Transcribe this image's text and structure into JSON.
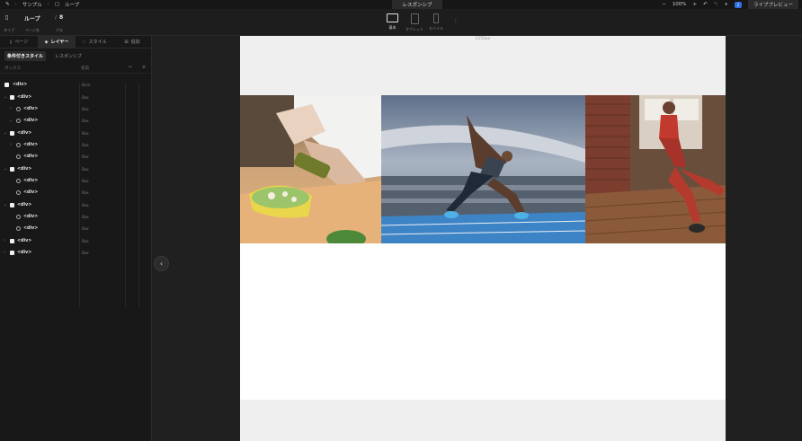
{
  "topbar": {
    "breadcrumb": [
      "サンプル",
      "ループ"
    ],
    "center_tab": "レスポンシブ",
    "zoom": "100%",
    "badge": "2",
    "live_preview": "ライブプレビュー"
  },
  "toolbar": {
    "type_label": "タイプ",
    "page_name": "ループ",
    "page_name_label": "ページ名",
    "path": "8",
    "path_label": "パス",
    "devices": [
      {
        "label": "基本",
        "active": true
      },
      {
        "label": "タブレット",
        "active": false
      },
      {
        "label": "モバイル",
        "active": false
      }
    ]
  },
  "left_panel": {
    "tabs": [
      "ページ",
      "レイヤー",
      "スタイル",
      "追加"
    ],
    "sub_tabs": [
      "条件付きスタイル",
      "レスポンシブ"
    ],
    "col_box": "ボックス",
    "col_name": "名前",
    "layers": [
      {
        "tag": "<div>",
        "name": "Box",
        "indent": 0,
        "kind": "box",
        "chev": ""
      },
      {
        "tag": "<div>",
        "name": "Box",
        "indent": 1,
        "kind": "box",
        "chev": "v"
      },
      {
        "tag": "<div>",
        "name": "Box",
        "indent": 2,
        "kind": "gear",
        "chev": ">"
      },
      {
        "tag": "<div>",
        "name": "Box",
        "indent": 2,
        "kind": "gear",
        "chev": ">"
      },
      {
        "tag": "<div>",
        "name": "Box",
        "indent": 1,
        "kind": "box",
        "chev": "v"
      },
      {
        "tag": "<div>",
        "name": "Box",
        "indent": 2,
        "kind": "gear",
        "chev": ">"
      },
      {
        "tag": "<div>",
        "name": "Box",
        "indent": 2,
        "kind": "gear",
        "chev": ""
      },
      {
        "tag": "<div>",
        "name": "Box",
        "indent": 1,
        "kind": "box",
        "chev": "v"
      },
      {
        "tag": "<div>",
        "name": "Box",
        "indent": 2,
        "kind": "gear",
        "chev": ""
      },
      {
        "tag": "<div>",
        "name": "Box",
        "indent": 2,
        "kind": "gear",
        "chev": ""
      },
      {
        "tag": "<div>",
        "name": "Box",
        "indent": 1,
        "kind": "box",
        "chev": "v"
      },
      {
        "tag": "<div>",
        "name": "Box",
        "indent": 2,
        "kind": "gear",
        "chev": ""
      },
      {
        "tag": "<div>",
        "name": "Box",
        "indent": 2,
        "kind": "gear",
        "chev": ""
      },
      {
        "tag": "<div>",
        "name": "Box",
        "indent": 1,
        "kind": "box",
        "chev": ">"
      },
      {
        "tag": "<div>",
        "name": "Box",
        "indent": 1,
        "kind": "box",
        "chev": ">"
      }
    ],
    "root_name": "Bnm"
  },
  "canvas": {
    "width_label": "1254px",
    "images": [
      "chef-salad-photo",
      "sprinter-stadium-photo",
      "fitness-woman-photo"
    ]
  }
}
